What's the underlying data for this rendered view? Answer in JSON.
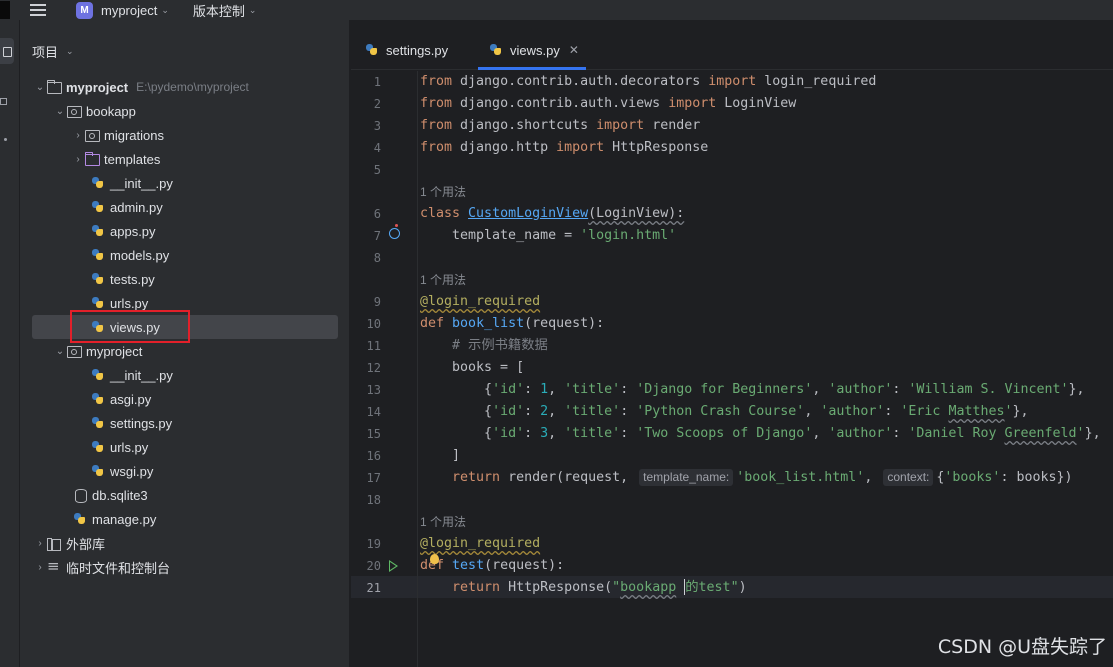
{
  "titlebar": {
    "project_badge": "M",
    "project_name": "myproject",
    "vcs_label": "版本控制"
  },
  "project_panel": {
    "header": "项目",
    "root_name": "myproject",
    "root_path": "E:\\pydemo\\myproject",
    "items": [
      {
        "label": "bookapp"
      },
      {
        "label": "migrations"
      },
      {
        "label": "templates"
      },
      {
        "label": "__init__.py"
      },
      {
        "label": "admin.py"
      },
      {
        "label": "apps.py"
      },
      {
        "label": "models.py"
      },
      {
        "label": "tests.py"
      },
      {
        "label": "urls.py"
      },
      {
        "label": "views.py"
      },
      {
        "label": "myproject"
      },
      {
        "label": "__init__.py"
      },
      {
        "label": "asgi.py"
      },
      {
        "label": "settings.py"
      },
      {
        "label": "urls.py"
      },
      {
        "label": "wsgi.py"
      },
      {
        "label": "db.sqlite3"
      },
      {
        "label": "manage.py"
      },
      {
        "label": "外部库"
      },
      {
        "label": "临时文件和控制台"
      }
    ]
  },
  "tabs": [
    {
      "label": "settings.py"
    },
    {
      "label": "views.py"
    }
  ],
  "editor": {
    "usage_hint": "1 个用法",
    "line_numbers": [
      "1",
      "2",
      "3",
      "4",
      "5",
      "6",
      "7",
      "8",
      "9",
      "10",
      "11",
      "12",
      "13",
      "14",
      "15",
      "16",
      "17",
      "18",
      "19",
      "20",
      "21"
    ],
    "code": {
      "l1": [
        "from",
        " django.contrib.auth.decorators ",
        "import",
        " login_required"
      ],
      "l2": [
        "from",
        " django.contrib.auth.views ",
        "import",
        " LoginView"
      ],
      "l3": [
        "from",
        " django.shortcuts ",
        "import",
        " render"
      ],
      "l4": [
        "from",
        " django.http ",
        "import",
        " HttpResponse"
      ],
      "l6": [
        "class",
        " ",
        "CustomLoginView",
        "(LoginView):"
      ],
      "l7": [
        "    template_name = ",
        "'login.html'"
      ],
      "l9": [
        "@login_required"
      ],
      "l10": [
        "def",
        " ",
        "book_list",
        "(request):"
      ],
      "l11": [
        "    # 示例书籍数据"
      ],
      "l12": [
        "    books = ["
      ],
      "l13": [
        "        {",
        "'id'",
        ": ",
        "1",
        ", ",
        "'title'",
        ": ",
        "'Django for Beginners'",
        ", ",
        "'author'",
        ": ",
        "'William S. Vincent'",
        "},"
      ],
      "l14": [
        "        {",
        "'id'",
        ": ",
        "2",
        ", ",
        "'title'",
        ": ",
        "'Python Crash Course'",
        ", ",
        "'author'",
        ": ",
        "'Eric ",
        "Matthes",
        "'",
        "},"
      ],
      "l15": [
        "        {",
        "'id'",
        ": ",
        "3",
        ", ",
        "'title'",
        ": ",
        "'Two Scoops of Django'",
        ", ",
        "'author'",
        ": ",
        "'Daniel Roy ",
        "Greenfeld",
        "'",
        "},"
      ],
      "l16": [
        "    ]"
      ],
      "l17": [
        "    ",
        "return",
        " render(request, ",
        "template_name:",
        "'book_list.html'",
        ", ",
        "context:",
        "{",
        "'books'",
        ": books})"
      ],
      "l19": [
        "@login_required"
      ],
      "l20": [
        "def",
        " ",
        "test",
        "(request):"
      ],
      "l21": [
        "    ",
        "return",
        " HttpResponse(",
        "\"",
        "bookapp",
        " ",
        "的test",
        "\"",
        ")"
      ]
    }
  },
  "watermark": "CSDN @U盘失踪了"
}
